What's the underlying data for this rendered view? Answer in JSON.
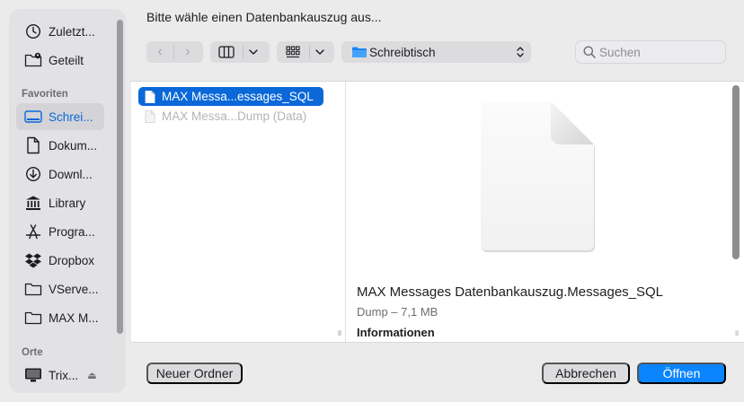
{
  "dialog": {
    "title": "Bitte wähle einen Datenbankauszug aus..."
  },
  "sidebar": {
    "top_items": [
      {
        "label": "Zuletzt...",
        "icon": "clock-icon"
      },
      {
        "label": "Geteilt",
        "icon": "shared-folder-icon"
      }
    ],
    "favorites_header": "Favoriten",
    "favorites": [
      {
        "label": "Schrei...",
        "icon": "desktop-icon",
        "selected": true
      },
      {
        "label": "Dokum...",
        "icon": "document-icon"
      },
      {
        "label": "Downl...",
        "icon": "download-icon"
      },
      {
        "label": "Library",
        "icon": "library-icon"
      },
      {
        "label": "Progra...",
        "icon": "applications-icon"
      },
      {
        "label": "Dropbox",
        "icon": "dropbox-icon"
      },
      {
        "label": "VServe...",
        "icon": "folder-icon"
      },
      {
        "label": "MAX M...",
        "icon": "folder-icon"
      }
    ],
    "places_header": "Orte",
    "places": [
      {
        "label": "Trix...",
        "icon": "monitor-icon",
        "eject": "⏏"
      }
    ]
  },
  "toolbar": {
    "back": "‹",
    "forward": "›",
    "view_icon": "columns-view-icon",
    "group_icon": "grid-view-icon",
    "location": "Schreibtisch"
  },
  "search": {
    "placeholder": "Suchen",
    "value": ""
  },
  "files": [
    {
      "name": "MAX Messa...essages_SQL",
      "selected": true
    },
    {
      "name": "MAX Messa...Dump (Data)",
      "selected": false,
      "dimmed": true
    }
  ],
  "preview": {
    "name": "MAX Messages Datenbankauszug.Messages_SQL",
    "meta": "Dump – 7,1 MB",
    "info_header": "Informationen"
  },
  "buttons": {
    "new_folder": "Neuer Ordner",
    "cancel": "Abbrechen",
    "open": "Öffnen"
  },
  "colors": {
    "accent": "#0a84ff",
    "selection": "#0a68d8",
    "background": "#ebebeb"
  }
}
